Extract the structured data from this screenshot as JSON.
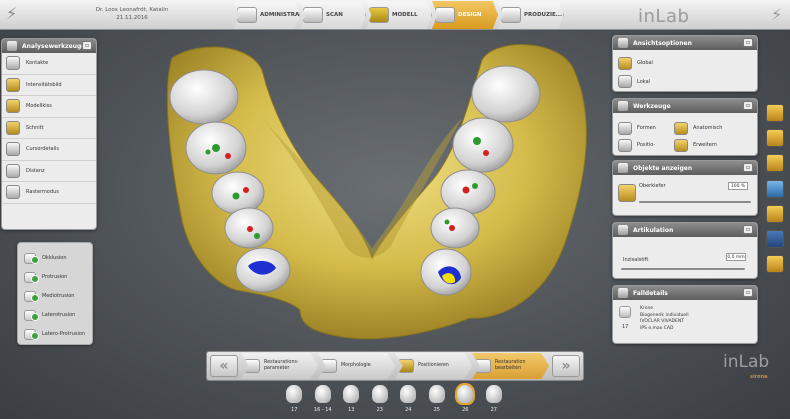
{
  "header": {
    "patient_name": "Dr. Loos Leonafrdt, Katalin",
    "date": "21.11.2016",
    "steps": [
      {
        "label": "ADMINISTRATION",
        "active": false
      },
      {
        "label": "SCAN",
        "active": false
      },
      {
        "label": "MODELL",
        "active": false
      },
      {
        "label": "DESIGN",
        "active": true
      },
      {
        "label": "PRODUZIE...",
        "active": false
      }
    ],
    "brand": "inLab"
  },
  "analysis_panel": {
    "title": "Analysewerkzeuge",
    "items": [
      "Kontakte",
      "Intensitätsbild",
      "Modellkiss",
      "Schnitt",
      "Cursordetails",
      "Distanz",
      "Rastermodus"
    ]
  },
  "movements_panel": {
    "items": [
      "Okklusion",
      "Protrusion",
      "Mediotrusion",
      "Laterotrusion",
      "Latero-Protrusion"
    ]
  },
  "view_options_panel": {
    "title": "Ansichtsoptionen",
    "items": [
      "Global",
      "Lokal"
    ]
  },
  "tools_panel": {
    "title": "Werkzeuge",
    "items": [
      "Formen",
      "Anatomisch",
      "Positio-",
      "Erweitern"
    ]
  },
  "objects_panel": {
    "title": "Objekte anzeigen",
    "row_label": "Oberkiefer",
    "value": "100 %"
  },
  "articulation_panel": {
    "title": "Artikulation",
    "row_label": "Inzisalstift",
    "value": "0,0 mm"
  },
  "case_details_panel": {
    "title": "Falldetails",
    "tooth_number": "17",
    "lines": [
      "Krone",
      "Biogenerik individuell",
      "IVOCLAR VIVADENT",
      "IPS e.max CAD"
    ]
  },
  "workflow": {
    "phases": [
      {
        "label1": "Restaurations-",
        "label2": "parameter",
        "active": false
      },
      {
        "label1": "Morphologie",
        "label2": "",
        "active": false
      },
      {
        "label1": "Positionieren",
        "label2": "",
        "active": false
      },
      {
        "label1": "Restauration",
        "label2": "bearbeiten",
        "active": true
      }
    ],
    "prev_icon": "«",
    "next_icon": "»"
  },
  "footer_brand": {
    "name": "inLab",
    "sub": "sirona"
  },
  "teeth": [
    "17",
    "16 - 14",
    "13",
    "23",
    "24",
    "25",
    "26",
    "27"
  ],
  "active_tooth": "26",
  "colors": {
    "accent": "#e3a12b",
    "model_gold": "#d9c24c",
    "contact_green": "#2e9a2e",
    "contact_red": "#d42020",
    "contact_blue": "#1f2fd0",
    "contact_yellow": "#f3e000"
  }
}
